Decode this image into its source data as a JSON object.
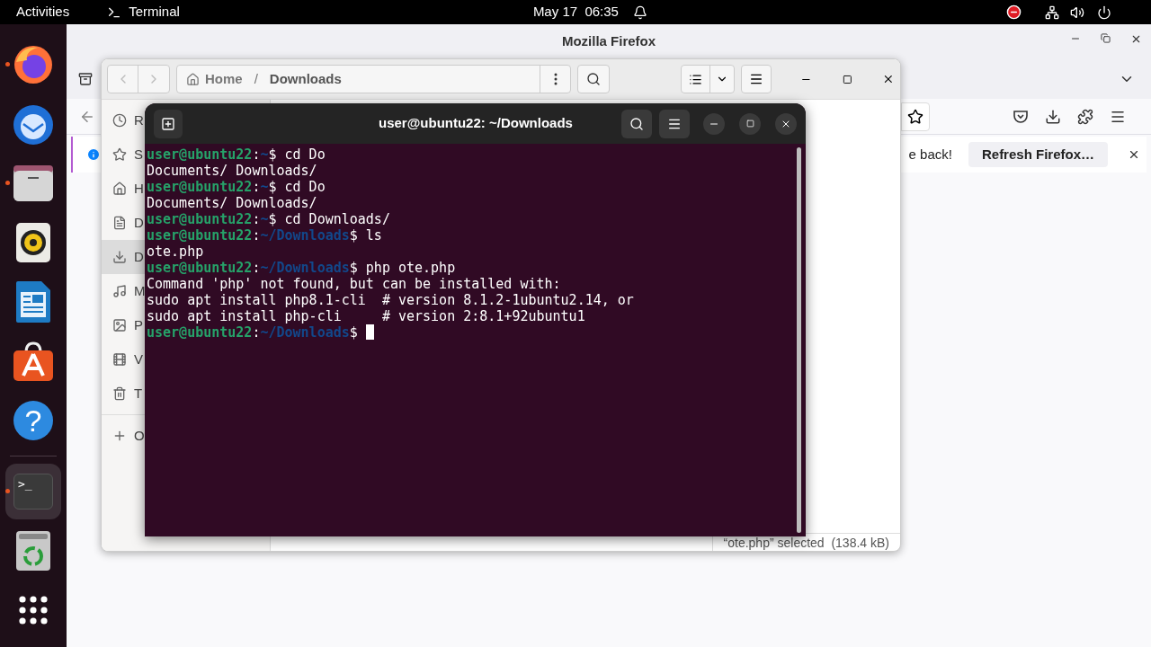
{
  "top_bar": {
    "activities": "Activities",
    "app": "Terminal",
    "clock": "May 17  06:35"
  },
  "dock": [
    {
      "kind": "browser",
      "running": true,
      "selected": false
    },
    {
      "kind": "mail",
      "running": false,
      "selected": false
    },
    {
      "kind": "files",
      "running": true,
      "selected": false
    },
    {
      "kind": "music",
      "running": false,
      "selected": false
    },
    {
      "kind": "writer",
      "running": false,
      "selected": false
    },
    {
      "kind": "store",
      "running": false,
      "selected": false
    },
    {
      "kind": "help",
      "glyph": "?",
      "running": false,
      "selected": false
    },
    {
      "kind": "terminal",
      "glyph": ">_",
      "running": true,
      "selected": true
    },
    {
      "kind": "trash",
      "running": false,
      "selected": false
    },
    {
      "kind": "apps",
      "running": false,
      "selected": false
    }
  ],
  "browser": {
    "title": "Mozilla Firefox",
    "notification": {
      "text": "e back!",
      "button": "Refresh Firefox…"
    }
  },
  "files": {
    "path": [
      "Home",
      "Downloads"
    ],
    "path_separator": "/",
    "sidebar": [
      {
        "label": "R",
        "selected": false
      },
      {
        "label": "S",
        "selected": false
      },
      {
        "label": "H",
        "selected": false
      },
      {
        "label": "D",
        "selected": false
      },
      {
        "label": "D",
        "selected": true
      },
      {
        "label": "M",
        "selected": false
      },
      {
        "label": "P",
        "selected": false
      },
      {
        "label": "V",
        "selected": false
      },
      {
        "label": "T",
        "selected": false
      },
      {
        "label": "O",
        "selected": false
      }
    ],
    "status": "“ote.php” selected  (138.4 kB)"
  },
  "terminal": {
    "title": "user@ubuntu22: ~/Downloads",
    "lines": [
      {
        "kind": "prompt",
        "user": "user@ubuntu22",
        "sep": ":",
        "path": "~",
        "mark": "$",
        "command": " cd Do"
      },
      {
        "kind": "output",
        "text": "Documents/ Downloads/"
      },
      {
        "kind": "prompt",
        "user": "user@ubuntu22",
        "sep": ":",
        "path": "~",
        "mark": "$",
        "command": " cd Do"
      },
      {
        "kind": "output",
        "text": "Documents/ Downloads/"
      },
      {
        "kind": "prompt",
        "user": "user@ubuntu22",
        "sep": ":",
        "path": "~",
        "mark": "$",
        "command": " cd Downloads/"
      },
      {
        "kind": "prompt",
        "user": "user@ubuntu22",
        "sep": ":",
        "path": "~/Downloads",
        "mark": "$",
        "command": " ls"
      },
      {
        "kind": "output",
        "text": "ote.php"
      },
      {
        "kind": "prompt",
        "user": "user@ubuntu22",
        "sep": ":",
        "path": "~/Downloads",
        "mark": "$",
        "command": " php ote.php"
      },
      {
        "kind": "output",
        "text": "Command 'php' not found, but can be installed with:"
      },
      {
        "kind": "output",
        "text": "sudo apt install php8.1-cli  # version 8.1.2-1ubuntu2.14, or"
      },
      {
        "kind": "output",
        "text": "sudo apt install php-cli     # version 2:8.1+92ubuntu1"
      },
      {
        "kind": "prompt",
        "user": "user@ubuntu22",
        "sep": ":",
        "path": "~/Downloads",
        "mark": "$",
        "cursor": true
      }
    ]
  }
}
